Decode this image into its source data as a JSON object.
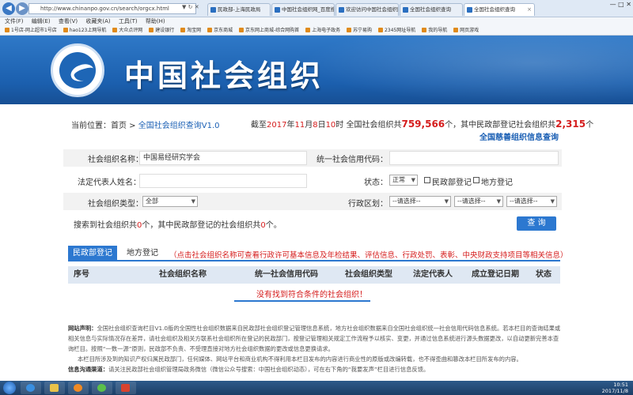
{
  "browser": {
    "address": "http://www.chinanpo.gov.cn/search/orgcx.html",
    "tabs": [
      {
        "label": "民政部-上海民政局"
      },
      {
        "label": "中国社会组织网_百度搜索"
      },
      {
        "label": "欢迎访问中国社会组织网"
      },
      {
        "label": "全国社会组织查询"
      },
      {
        "label": "全国社会组织查询"
      }
    ],
    "menu": [
      "文件(F)",
      "编辑(E)",
      "查看(V)",
      "收藏夹(A)",
      "工具(T)",
      "帮助(H)"
    ],
    "favorites": [
      "1号店-网上超市1号店",
      "hao123上网导航",
      "大众点评网",
      "建设银行",
      "淘宝网",
      "京东商城",
      "京东网上商城-综合网购首",
      "上海电子政务",
      "苏宁易购",
      "2345网址导航",
      "我的导航",
      "网页游戏"
    ]
  },
  "header": {
    "site_title": "中国社会组织"
  },
  "info": {
    "location_label": "当前位置：",
    "crumb_home": "首页",
    "crumb_sep": " > ",
    "crumb_current": "全国社会组织查询V1.0",
    "stats_prefix": "截至",
    "year": "2017",
    "year_unit": "年",
    "month": "11",
    "month_unit": "月",
    "day": "8",
    "day_unit": "日",
    "hour": "10",
    "hour_unit": "时 全国社会组织共",
    "total": "759,566",
    "total_unit": "个，其中民政部登记社会组织共",
    "ministry_total": "2,315",
    "ministry_unit": "个",
    "charity_link": "全国慈善组织信息查询"
  },
  "form": {
    "org_name_label": "社会组织名称：",
    "org_name_value": "中国易经研究学会",
    "credit_code_label": "统一社会信用代码：",
    "credit_code_value": "",
    "legal_rep_label": "法定代表人姓名：",
    "legal_rep_value": "",
    "status_label": "状态：",
    "status_value": "正常",
    "chk_ministry_label": "民政部登记",
    "chk_local_label": "地方登记",
    "org_type_label": "社会组织类型：",
    "org_type_value": "全部",
    "region_label": "行政区划：",
    "region_options": [
      "--请选择--",
      "--请选择--",
      "--请选择--"
    ]
  },
  "result": {
    "prefix": "搜索到社会组织共",
    "count": "0",
    "mid": "个，其中民政部登记的社会组织共",
    "ministry_count": "0",
    "suffix": "个。",
    "query_label": "查 询"
  },
  "tabs": {
    "civil": "民政部登记",
    "local": "地方登记",
    "note": "（点击社会组织名称可查看行政许可基本信息及年检结果、评估信息、行政处罚、表彰、中央财政支持项目等相关信息）"
  },
  "table": {
    "headers": [
      "序号",
      "社会组织名称",
      "统一社会信用代码",
      "社会组织类型",
      "法定代表人",
      "成立登记日期",
      "状态"
    ],
    "empty_message": "没有找到符合条件的社会组织！"
  },
  "disclaimer": {
    "title": "网站声明：",
    "p1": "全国社会组织查询栏目V1.0版的全国性社会组织数据来自民政部社会组织登记管理信息系统，地方社会组织数据来自全国社会组织统一社会信用代码信息系统。若本栏目的查询结果或相关信息与实际情况存在差异，请社会组织及相关方联系社会组织所在登记的民政部门，按登记管理相关规定工作流程予以核实、变更，并通过信息系统进行源头数据更改，以自动更新完善本查询栏目。按照“一数一源”原则，民政部不负责、不受理直接对地方社会组织数据的更改或信息更换请求。",
    "p2": "本栏目所涉及到的知识产权归属民政部门，任何媒体、网站平台和商业机构不得利用本栏目发布的内容进行商业性的原版或改编转载，也不得歪曲和篡改本栏目所发布的内容。",
    "contact_title": "信息沟通渠道：",
    "contact_text": "请关注民政部社会组织管理局政务微信（微信公众号搜索：中国社会组织动态），可在右下角的“我要发声”栏目进行信息反馈。"
  },
  "taskbar": {
    "time": "10:51",
    "date": "2017/11/8"
  },
  "colors": {
    "brand_blue": "#2c78d0",
    "banner_blue": "#1b5fae",
    "alert_red": "#d51d1d"
  }
}
